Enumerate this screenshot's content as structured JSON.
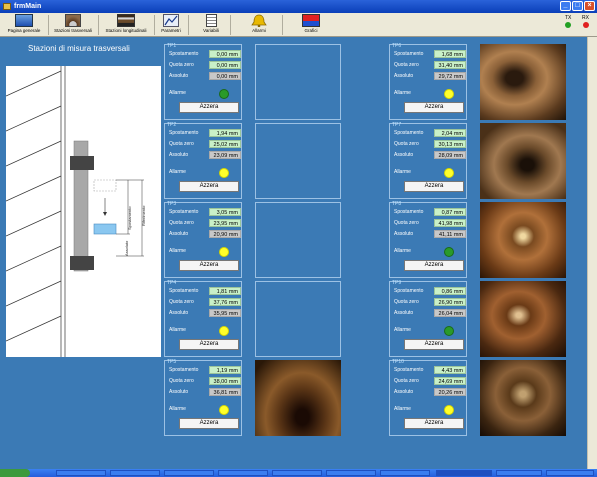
{
  "window": {
    "title": "frmMain"
  },
  "toolbar": {
    "buttons": [
      {
        "label": "Pagina generale",
        "icon": "home-icon"
      },
      {
        "label": "Stazioni trasversali",
        "icon": "tunnel-section-icon"
      },
      {
        "label": "Stazioni longitudinali",
        "icon": "longitudinal-icon"
      },
      {
        "label": "Parametri",
        "icon": "parameters-icon"
      },
      {
        "label": "Variabili",
        "icon": "variables-icon"
      },
      {
        "label": "Allarmi",
        "icon": "bell-icon"
      },
      {
        "label": "Grafici",
        "icon": "chart-icon"
      }
    ],
    "tx": "TX",
    "rx": "RX"
  },
  "section_title": "Stazioni di misura trasversali",
  "diagram": {
    "label_a": "Spostamento",
    "label_b": "Riferimento",
    "label_c": "Assoluto"
  },
  "labels": {
    "spostamento": "Spostamento",
    "quota_zero": "Quota zero",
    "assoluto": "Assoluto",
    "allarme": "Allarme",
    "azzera": "Azzera"
  },
  "colors": {
    "ok": "#2a9a2a",
    "warning": "#ffff2a"
  },
  "stations": [
    {
      "name": "TP1",
      "spostamento": "0,00 mm",
      "quota_zero": "0,00 mm",
      "assoluto": "0,00 mm",
      "alarm": "green"
    },
    {
      "name": "TP2",
      "spostamento": "1,94 mm",
      "quota_zero": "25,02 mm",
      "assoluto": "23,09 mm",
      "alarm": "yellow"
    },
    {
      "name": "TP3",
      "spostamento": "3,05 mm",
      "quota_zero": "23,95 mm",
      "assoluto": "20,90 mm",
      "alarm": "yellow"
    },
    {
      "name": "TP4",
      "spostamento": "1,81 mm",
      "quota_zero": "37,76 mm",
      "assoluto": "35,95 mm",
      "alarm": "yellow"
    },
    {
      "name": "TP5",
      "spostamento": "1,19 mm",
      "quota_zero": "38,00 mm",
      "assoluto": "36,81 mm",
      "alarm": "yellow"
    },
    {
      "name": "TP6",
      "spostamento": "1,68 mm",
      "quota_zero": "31,40 mm",
      "assoluto": "29,72 mm",
      "alarm": "yellow"
    },
    {
      "name": "TP7",
      "spostamento": "2,04 mm",
      "quota_zero": "30,13 mm",
      "assoluto": "28,09 mm",
      "alarm": "yellow"
    },
    {
      "name": "TP8",
      "spostamento": "0,87 mm",
      "quota_zero": "41,98 mm",
      "assoluto": "41,11 mm",
      "alarm": "green"
    },
    {
      "name": "TP9",
      "spostamento": "0,86 mm",
      "quota_zero": "26,90 mm",
      "assoluto": "26,04 mm",
      "alarm": "green"
    },
    {
      "name": "TP10",
      "spostamento": "4,43 mm",
      "quota_zero": "24,69 mm",
      "assoluto": "20,26 mm",
      "alarm": "yellow"
    }
  ],
  "taskbar": {
    "start": "start"
  }
}
